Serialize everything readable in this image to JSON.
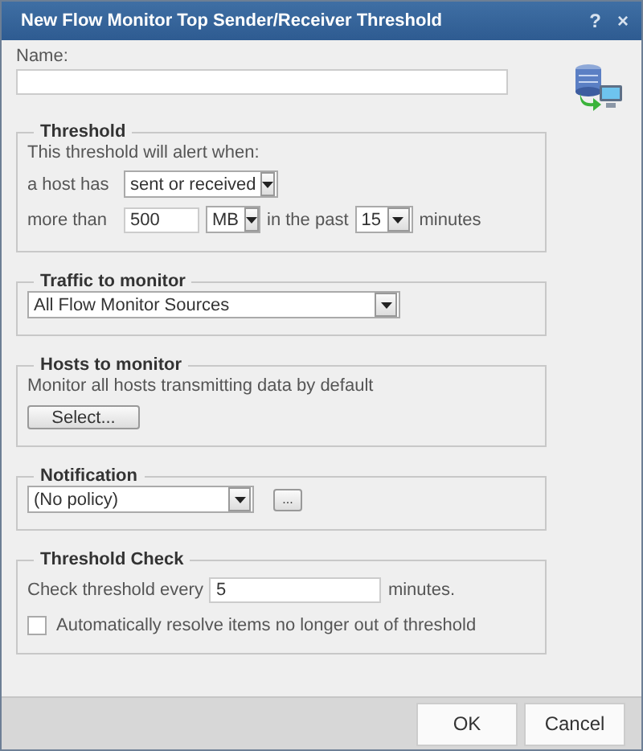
{
  "window": {
    "title": "New Flow Monitor Top Sender/Receiver Threshold",
    "help": "?",
    "close": "×"
  },
  "name_field": {
    "label": "Name:"
  },
  "threshold": {
    "legend": "Threshold",
    "intro": "This threshold will alert when:",
    "host_label": "a host has",
    "direction": "sent or received",
    "more_label": "more than",
    "amount": "500",
    "unit": "MB",
    "past_label": "in the past",
    "period": "15",
    "period_unit": "minutes"
  },
  "traffic": {
    "legend": "Traffic to monitor",
    "source": "All Flow Monitor Sources"
  },
  "hosts": {
    "legend": "Hosts to monitor",
    "note": "Monitor all hosts transmitting data by default",
    "button": "Select..."
  },
  "notification": {
    "legend": "Notification",
    "policy": "(No policy)",
    "button": "..."
  },
  "check": {
    "legend": "Threshold Check",
    "label": "Check threshold every",
    "interval": "5",
    "unit": "minutes.",
    "auto_resolve": {
      "label": "Automatically resolve items no longer out of threshold",
      "checked": false
    }
  },
  "buttons": [
    "OK",
    "Cancel"
  ]
}
